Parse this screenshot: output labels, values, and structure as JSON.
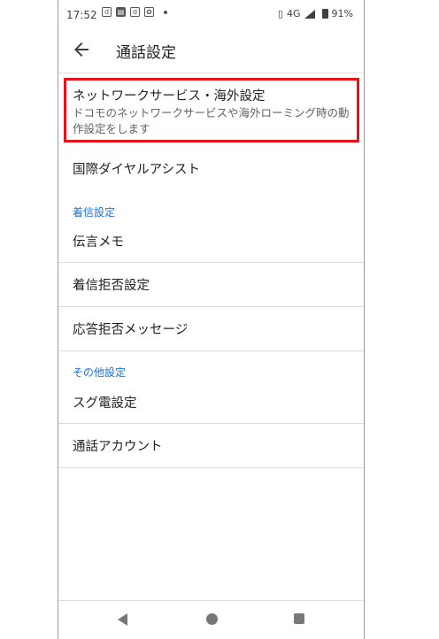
{
  "status_bar": {
    "time": "17:52",
    "network": "4G",
    "battery": "91%",
    "notification_icons": [
      "d",
      "book-icon",
      "d",
      "photo-icon"
    ]
  },
  "app_bar": {
    "title": "通話設定"
  },
  "items": {
    "network_title": "ネットワークサービス・海外設定",
    "network_summary": "ドコモのネットワークサービスや海外ローミング時の動作設定をします",
    "intl_dial": "国際ダイヤルアシスト",
    "voicemail": "伝言メモ",
    "call_reject": "着信拒否設定",
    "reply_reject": "応答拒否メッセージ",
    "quick_dial": "スグ電設定",
    "call_accounts": "通話アカウント"
  },
  "sections": {
    "incoming": "着信設定",
    "other": "その他設定"
  },
  "colors": {
    "highlight": "#e6131b",
    "section_accent": "#1a73e8"
  }
}
